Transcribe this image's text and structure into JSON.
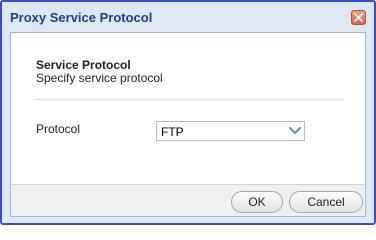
{
  "dialog": {
    "title": "Proxy Service Protocol",
    "close_icon": "close-icon"
  },
  "section": {
    "title": "Service Protocol",
    "description": "Specify service protocol"
  },
  "form": {
    "protocol_label": "Protocol",
    "protocol_value": "FTP",
    "dropdown_icon": "chevron-down-icon"
  },
  "footer": {
    "ok_label": "OK",
    "cancel_label": "Cancel"
  },
  "colors": {
    "title_text": "#15428b",
    "frame_border": "#3a4fc4",
    "header_bg": "#dfe7f3",
    "close_button": "#dd6647",
    "chevron": "#5a8bd6"
  }
}
